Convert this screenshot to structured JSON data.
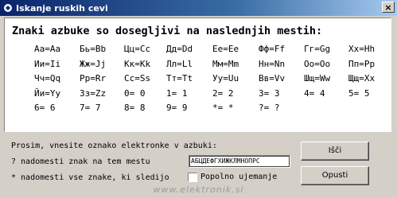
{
  "window": {
    "title": "Iskanje ruskih cevi",
    "close_label": "×"
  },
  "panel": {
    "heading": "Znaki azbuke so dosegljivi na naslednjih mestih:",
    "rows": [
      [
        "Аа=Aa",
        "Бь=Bb",
        "Цц=Cc",
        "Дд=Dd",
        "Ее=Ee",
        "Фф=Ff",
        "Гг=Gg",
        "Хх=Hh"
      ],
      [
        "Ии=Ii",
        "Жж=Jj",
        "Кк=Kk",
        "Лл=Ll",
        "Мм=Mm",
        "Нн=Nn",
        "Оо=Oo",
        "Пп=Pp"
      ],
      [
        "Чч=Qq",
        "Рр=Rr",
        "Сс=Ss",
        "Тт=Tt",
        "Уу=Uu",
        "Вв=Vv",
        "Шщ=Ww",
        "Щщ=Xx"
      ],
      [
        "Йи=Yy",
        "Зз=Zz",
        "0= 0",
        "1= 1",
        "2= 2",
        "3= 3",
        "4= 4",
        "5= 5"
      ],
      [
        "6= 6",
        "7= 7",
        "8= 8",
        "9= 9",
        "*= *",
        "?= ?",
        "",
        ""
      ]
    ]
  },
  "form": {
    "prompt": "Prosim, vnesite oznako elektronke v azbuki:",
    "hint_question": "? nadomesti znak na tem mestu",
    "hint_star": "* nadomesti vse znake, ki sledijo",
    "search_value": "АБЦДЕФГХИЖКЛМНОПРС",
    "exact_match_label": "Popolno ujemanje",
    "search_button": "Išči",
    "cancel_button": "Opusti"
  },
  "watermark": "www.elektronik.si"
}
